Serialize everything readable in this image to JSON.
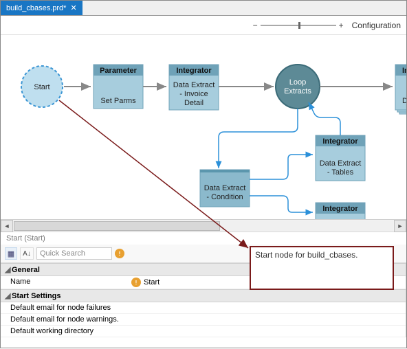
{
  "tab": {
    "title": "build_cbases.prd*",
    "close": "✕"
  },
  "toolbar": {
    "minus": "−",
    "plus": "+",
    "config": "Configuration"
  },
  "nodes": {
    "start": "Start",
    "parameter": {
      "title": "Parameter",
      "sub": "Set Parms"
    },
    "integ1": {
      "title": "Integrator",
      "sub1": "Data Extract",
      "sub2": "- Invoice",
      "sub3": "Detail"
    },
    "loop": {
      "l1": "Loop",
      "l2": "Extracts"
    },
    "integ_r": {
      "title": "Inte",
      "sub1": "Data"
    },
    "cond": {
      "sub1": "Data Extract",
      "sub2": "- Condition"
    },
    "integ_tables": {
      "title": "Integrator",
      "sub1": "Data Extract",
      "sub2": "- Tables"
    },
    "integ_bottom": {
      "title": "Integrator"
    }
  },
  "scroll": {
    "left": "◄",
    "right": "►"
  },
  "props": {
    "header": "Start (Start)",
    "search_placeholder": "Quick Search",
    "group_general": "General",
    "row_name_k": "Name",
    "row_name_v": "Start",
    "group_settings": "Start Settings",
    "row_fail": "Default email for node failures",
    "row_warn": "Default email for node warnings.",
    "row_wd": "Default working directory"
  },
  "callout": {
    "text": "Start node for build_cbases."
  }
}
